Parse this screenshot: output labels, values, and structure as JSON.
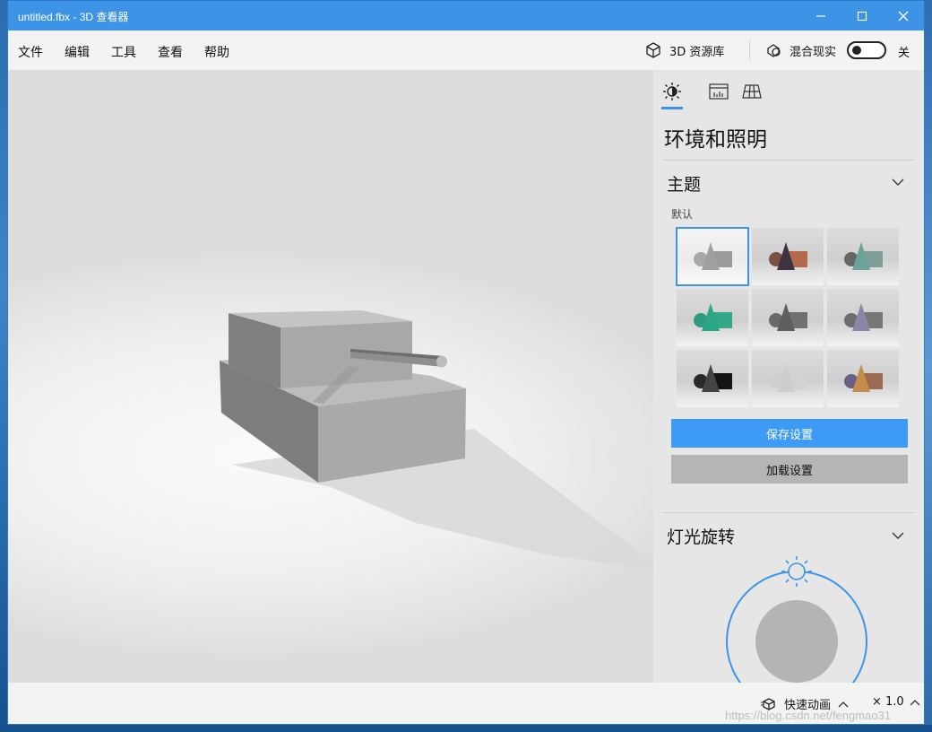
{
  "window": {
    "title": "untitled.fbx - 3D 查看器",
    "minimize_icon": "minimize-icon",
    "maximize_icon": "maximize-icon",
    "close_icon": "close-icon"
  },
  "menu": {
    "items": [
      "文件",
      "编辑",
      "工具",
      "查看",
      "帮助"
    ],
    "library_label": "3D 资源库",
    "mixed_reality_label": "混合现实",
    "toggle_state": "关"
  },
  "panel": {
    "tabs": [
      "environment-lighting-icon",
      "stats-shading-icon",
      "grid-icon"
    ],
    "title": "环境和照明",
    "theme_section": "主题",
    "theme_default_label": "默认",
    "themes": [
      {
        "sphere": "#a8a8a8",
        "cone": "#a0a0a0",
        "box": "#9a9a9a"
      },
      {
        "sphere": "#7a4f44",
        "cone": "#3d3440",
        "box": "#b36a4b"
      },
      {
        "sphere": "#666666",
        "cone": "#6aa39a",
        "box": "#7f9e98"
      },
      {
        "sphere": "#2e9a80",
        "cone": "#2aa684",
        "box": "#32a888"
      },
      {
        "sphere": "#6a6a6a",
        "cone": "#5e5e5e",
        "box": "#707070"
      },
      {
        "sphere": "#6d6d6d",
        "cone": "#8a86a8",
        "box": "#777777"
      },
      {
        "sphere": "#2a2a2a",
        "cone": "#444444",
        "box": "#151515"
      },
      {
        "sphere": "#cfcfcf",
        "cone": "#cdcdcd",
        "box": "#d2d2d2"
      },
      {
        "sphere": "#6b5f86",
        "cone": "#c58d4c",
        "box": "#9a6a52"
      }
    ],
    "save_button": "保存设置",
    "load_button": "加载设置",
    "light_section": "灯光旋转",
    "accent": "#3d94e6"
  },
  "statusbar": {
    "animation_label": "快速动画",
    "speed_value": "× 1.0",
    "watermark": "https://blog.csdn.net/fengmao31"
  }
}
